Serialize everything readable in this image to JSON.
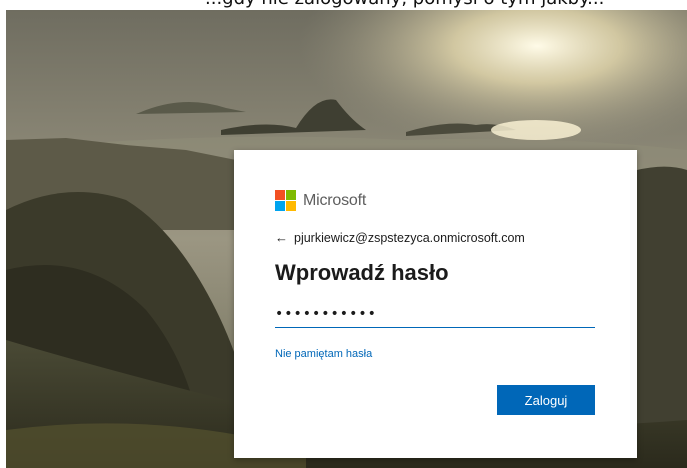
{
  "header": {
    "partial_text": "...gdy nie zalogowany, pomyśl o tym jakby..."
  },
  "brand": {
    "name": "Microsoft",
    "colors": [
      "#f25022",
      "#7fba00",
      "#00a4ef",
      "#ffb900"
    ]
  },
  "signin": {
    "back_icon": "←",
    "account": "pjurkiewicz@zspstezyca.onmicrosoft.com",
    "title": "Wprowadź hasło",
    "password_masked": "•••••••••••",
    "forgot_link": "Nie pamiętam hasła",
    "submit_label": "Zaloguj",
    "accent_color": "#0067b8"
  }
}
